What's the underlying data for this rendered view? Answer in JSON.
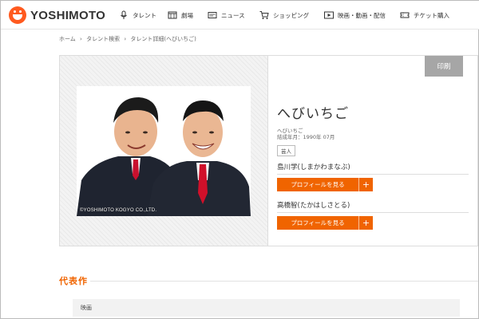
{
  "header": {
    "logo_text": "YOSHIMOTO",
    "nav": [
      {
        "label": "タレント",
        "icon": "microphone-icon"
      },
      {
        "label": "劇場",
        "icon": "theater-icon"
      },
      {
        "label": "ニュース",
        "icon": "news-icon"
      },
      {
        "label": "ショッピング",
        "icon": "cart-icon"
      },
      {
        "label": "映画・動画・配信",
        "icon": "video-icon"
      },
      {
        "label": "チケット購入",
        "icon": "ticket-icon"
      }
    ]
  },
  "breadcrumb": {
    "items": [
      "ホーム",
      "タレント検索",
      "タレント詳細(へびいちご)"
    ],
    "separator": "›"
  },
  "card": {
    "print_label": "印刷",
    "photo_copyright": "©YOSHIMOTO KOGYO CO.,LTD.",
    "title": "へびいちご",
    "reading": "へびいちご",
    "formed": "結成年月：1990年 07月",
    "category_tag": "芸人",
    "members": [
      {
        "name": "島川学(しまかわまなぶ)",
        "button_label": "プロフィールを見る",
        "plus": "+"
      },
      {
        "name": "高橋智(たかはしさとる)",
        "button_label": "プロフィールを見る",
        "plus": "+"
      }
    ]
  },
  "works": {
    "title": "代表作",
    "rows": [
      "映画"
    ]
  },
  "colors": {
    "accent": "#f06400",
    "logo": "#ff5a1f",
    "print_button": "#a6a6a6"
  }
}
